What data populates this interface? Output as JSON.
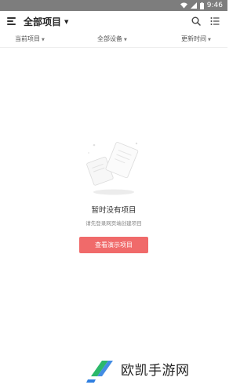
{
  "status_bar": {
    "time": "9:46"
  },
  "app_bar": {
    "title": "全部项目"
  },
  "filters": [
    {
      "label": "当前项目"
    },
    {
      "label": "全部设备"
    },
    {
      "label": "更新时间"
    }
  ],
  "empty_state": {
    "title": "暂时没有项目",
    "subtitle": "请先登录网页端创建项目",
    "button_label": "查看演示项目"
  },
  "watermark": {
    "text": "欧凯手游网"
  },
  "colors": {
    "accent": "#f06a6a",
    "status_bar": "#7d7d7d",
    "watermark_green": "#2bb86a",
    "watermark_blue": "#2f7fe0"
  }
}
